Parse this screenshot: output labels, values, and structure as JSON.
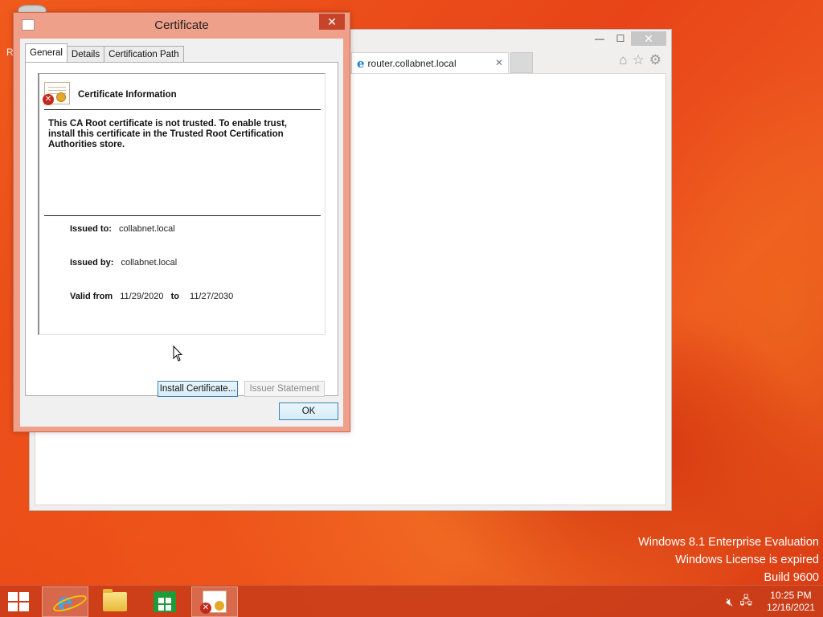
{
  "desktop": {
    "partial_label": "R"
  },
  "browser": {
    "tab_title": "router.collabnet.local",
    "tab_close": "✕",
    "minimize": "—",
    "maximize": "☐",
    "close": "✕",
    "icons": [
      "home-icon",
      "favorites-star-icon",
      "tools-gear-icon"
    ]
  },
  "dialog": {
    "title": "Certificate",
    "close": "✕",
    "tabs": [
      "General",
      "Details",
      "Certification Path"
    ],
    "active_tab": "General",
    "heading": "Certificate Information",
    "message": "This CA Root certificate is not trusted. To enable trust, install this certificate in the Trusted Root Certification Authorities store.",
    "issued_to_label": "Issued to:",
    "issued_to_value": "collabnet.local",
    "issued_by_label": "Issued by:",
    "issued_by_value": "collabnet.local",
    "valid_from_label": "Valid from",
    "valid_from_value": "11/29/2020",
    "valid_to_label": "to",
    "valid_to_value": "11/27/2030",
    "install_button": "Install Certificate...",
    "issuer_button": "Issuer Statement",
    "ok_button": "OK"
  },
  "watermark": {
    "line1": "Windows 8.1 Enterprise Evaluation",
    "line2": "Windows License is expired",
    "line3": "Build 9600"
  },
  "taskbar": {
    "apps": [
      "internet-explorer",
      "file-explorer",
      "store",
      "certificate"
    ],
    "time": "10:25 PM",
    "date": "12/16/2021"
  },
  "colors": {
    "desktop_accent": "#e8491c",
    "dialog_frame": "#eea08a",
    "close_button": "#c7442a",
    "focus_border": "#3c7fb1"
  }
}
